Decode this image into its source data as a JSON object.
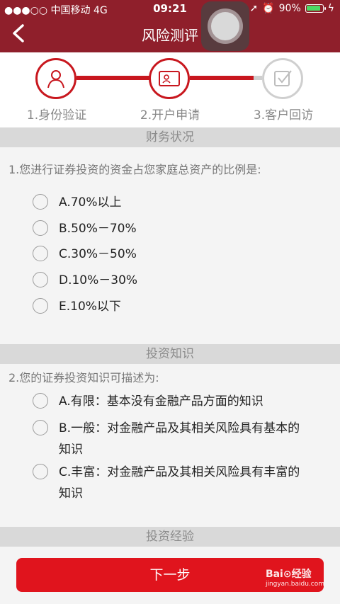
{
  "status_bar": {
    "carrier": "●●●○○ 中国移动  4G",
    "time": "09:21",
    "battery": "90%"
  },
  "nav": {
    "title": "风险测评",
    "back_glyph": "<"
  },
  "steps": [
    {
      "label": "1.身份验证",
      "active": true
    },
    {
      "label": "2.开户申请",
      "active": true
    },
    {
      "label": "3.客户回访",
      "active": false
    }
  ],
  "sections": [
    {
      "title": "财务状况",
      "question": "1.您进行证券投资的资金占您家庭总资产的比例是:",
      "options": [
        "A.70%以上",
        "B.50%－70%",
        "C.30%－50%",
        "D.10%－30%",
        "E.10%以下"
      ]
    },
    {
      "title": "投资知识",
      "question": "2.您的证券投资知识可描述为:",
      "options": [
        "A.有限：基本没有金融产品方面的知识",
        "B.一般：对金融产品及其相关风险具有基本的知识",
        "C.丰富：对金融产品及其相关风险具有丰富的知识"
      ]
    },
    {
      "title": "投资经验"
    }
  ],
  "next_button": {
    "label": "下一步"
  },
  "watermark": {
    "text": "Bai⊙经验",
    "sub": "jingyan.baidu.com"
  },
  "colors": {
    "brand": "#8f1f2b",
    "accent": "#c8171e",
    "button": "#e0141d"
  },
  "icons": [
    "signal-icon",
    "location-icon",
    "alarm-icon",
    "battery-icon",
    "back-arrow-icon",
    "user-icon",
    "id-card-icon",
    "checkbox-icon",
    "assistive-touch-icon"
  ]
}
